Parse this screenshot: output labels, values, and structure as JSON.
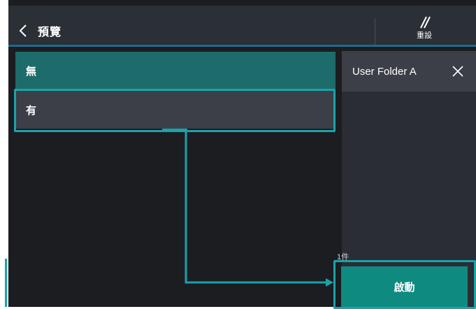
{
  "header": {
    "title": "預覽",
    "reset_label": "重設"
  },
  "options": [
    {
      "label": "無",
      "selected": true
    },
    {
      "label": "有",
      "selected": false
    }
  ],
  "folder": {
    "name": "User Folder A"
  },
  "count_label": "1件",
  "start_label": "啟動",
  "colors": {
    "accent": "#1aa3aa",
    "selected_option": "#1d6b6b",
    "start_button": "#0f8a80",
    "header_line": "#1f6a8f"
  }
}
